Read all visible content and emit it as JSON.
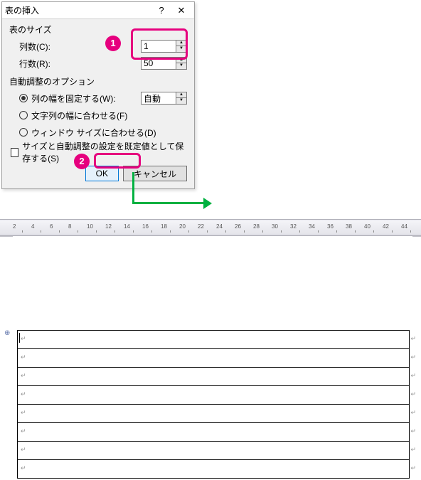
{
  "dialog": {
    "title": "表の挿入",
    "help": "?",
    "close": "✕",
    "size_label": "表のサイズ",
    "columns_label": "列数(C):",
    "columns_value": "1",
    "rows_label": "行数(R):",
    "rows_value": "50",
    "autofit_label": "自動調整のオプション",
    "opt_fixed": "列の幅を固定する(W):",
    "opt_fixed_value": "自動",
    "opt_content": "文字列の幅に合わせる(F)",
    "opt_window": "ウィンドウ サイズに合わせる(D)",
    "save_default": "サイズと自動調整の設定を既定値として保存する(S)",
    "ok": "OK",
    "cancel": "キャンセル"
  },
  "markers": {
    "m1": "1",
    "m2": "2"
  },
  "ruler": {
    "ticks": [
      2,
      4,
      6,
      8,
      10,
      12,
      14,
      16,
      18,
      20,
      22,
      24,
      26,
      28,
      30,
      32,
      34,
      36,
      38,
      40,
      42,
      44
    ]
  },
  "table": {
    "rows": 8,
    "cell_glyph": "↵",
    "row_glyph": "↵"
  }
}
